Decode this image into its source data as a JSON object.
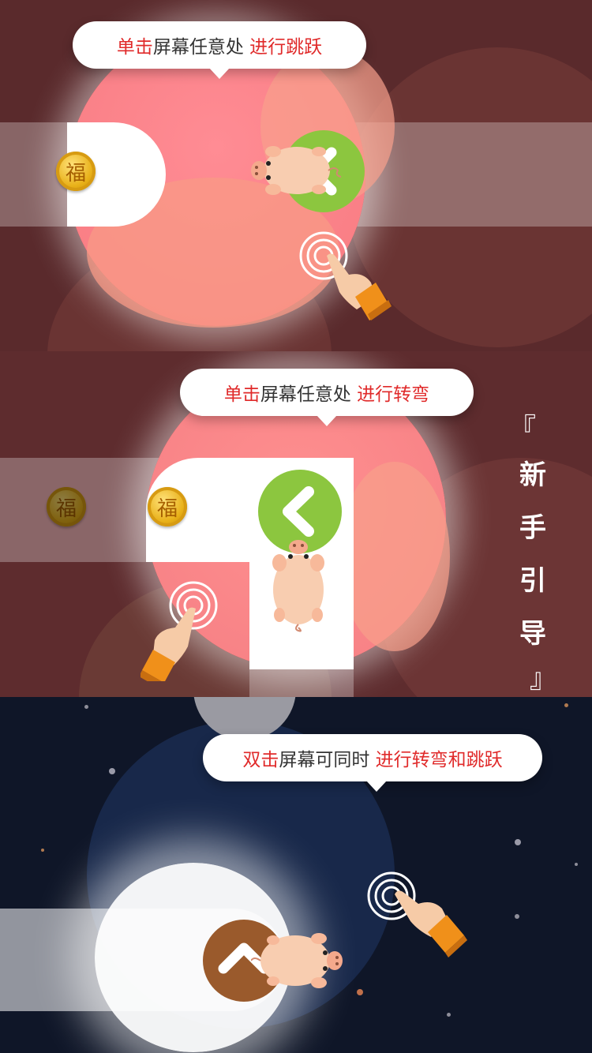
{
  "guide": {
    "title": "新手引导",
    "title_chars": [
      "新",
      "手",
      "引",
      "导"
    ],
    "bracket_open": "『",
    "bracket_close": "』"
  },
  "steps": [
    {
      "prefix": "单击",
      "middle": "屏幕任意处",
      "suffix": "进行跳跃"
    },
    {
      "prefix": "单击",
      "middle": "屏幕任意处",
      "suffix": "进行转弯"
    },
    {
      "prefix": "双击",
      "middle": "屏幕可同时",
      "suffix": "进行转弯和跳跃"
    }
  ],
  "coin_glyph": "福",
  "colors": {
    "highlight_red": "#e02a2a",
    "arrow_green": "#8cc63f",
    "arrow_brown": "#9a5a2c",
    "spot_pink": "#ff8a8a",
    "night_bg": "#0f1628",
    "cuff_orange": "#f0901a"
  },
  "icons": [
    "left-arrow-icon",
    "up-arrow-icon",
    "tap-ripple-icon",
    "pointing-hand-icon",
    "pig-icon",
    "coin-icon"
  ]
}
